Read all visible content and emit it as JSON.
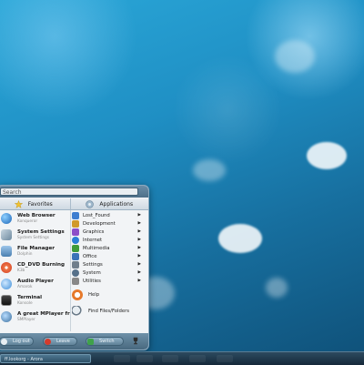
{
  "desktop": {
    "wallpaper_colors": [
      "#2aa7d8",
      "#176f9f",
      "#0f5078"
    ]
  },
  "menu": {
    "search_text": "Search",
    "header": {
      "favorites_label": "Favorites",
      "applications_label": "Applications"
    },
    "favorites": [
      {
        "title": "Web Browser",
        "subtitle": "Konqueror",
        "icon": "globe-icon",
        "color": "#2b7fd0"
      },
      {
        "title": "System Settings",
        "subtitle": "System Settings",
        "icon": "tools-icon",
        "color": "#6e8aa0"
      },
      {
        "title": "File Manager",
        "subtitle": "Dolphin",
        "icon": "folder-icon",
        "color": "#4a7fb0"
      },
      {
        "title": "CD_DVD Burning",
        "subtitle": "K3b",
        "icon": "disc-icon",
        "color": "#d23a1e"
      },
      {
        "title": "Audio Player",
        "subtitle": "Amarok",
        "icon": "audio-icon",
        "color": "#3e8ed8"
      },
      {
        "title": "Terminal",
        "subtitle": "Konsole",
        "icon": "terminal-icon",
        "color": "#222222"
      },
      {
        "title": "A great MPlayer fr",
        "subtitle": "SMPlayer",
        "icon": "mplayer-icon",
        "color": "#3a6f9e"
      }
    ],
    "applications": [
      {
        "label": "Lost_Found",
        "icon": "lost-found-icon",
        "color": "#3e7ed0"
      },
      {
        "label": "Development",
        "icon": "development-icon",
        "color": "#d09a2a"
      },
      {
        "label": "Graphics",
        "icon": "graphics-icon",
        "color": "#8c4fc8"
      },
      {
        "label": "Internet",
        "icon": "internet-icon",
        "color": "#2a7ed6"
      },
      {
        "label": "Multimedia",
        "icon": "multimedia-icon",
        "color": "#3f9b3a"
      },
      {
        "label": "Office",
        "icon": "office-icon",
        "color": "#3b73b8"
      },
      {
        "label": "Settings",
        "icon": "settings-icon",
        "color": "#6f7e8c"
      },
      {
        "label": "System",
        "icon": "system-icon",
        "color": "#55708a"
      },
      {
        "label": "Utilities",
        "icon": "utilities-icon",
        "color": "#888888"
      }
    ],
    "extras": [
      {
        "label": "Help",
        "icon": "help-icon",
        "color": "#e6792b"
      },
      {
        "label": "Find Files/Folders",
        "icon": "find-icon",
        "color": "#6a7a88"
      }
    ],
    "buttons": {
      "logout": "Log out",
      "leave": "Leave",
      "switch": "Switch"
    }
  },
  "taskbar": {
    "window_title": "ff.lookorg - Arora"
  }
}
